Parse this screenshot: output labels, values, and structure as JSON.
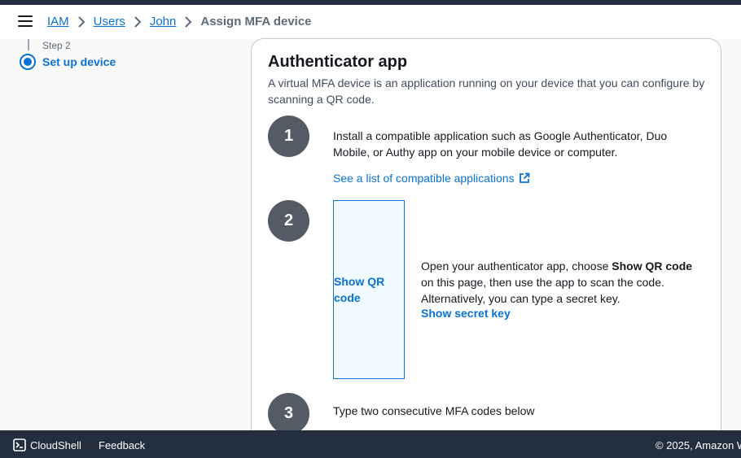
{
  "breadcrumb": {
    "items": [
      "IAM",
      "Users",
      "John"
    ],
    "current": "Assign MFA device"
  },
  "steps": {
    "caption": "Step 2",
    "title": "Set up device"
  },
  "card": {
    "title": "Authenticator app",
    "description": "A virtual MFA device is an application running on your device that you can configure by scanning a QR code.",
    "step1": {
      "number": "1",
      "text": "Install a compatible application such as Google Authenticator, Duo Mobile, or Authy app on your mobile device or computer.",
      "link": "See a list of compatible applications"
    },
    "step2": {
      "number": "2",
      "qr_button": "Show QR code",
      "text_pre": "Open your authenticator app, choose ",
      "text_bold": "Show QR code",
      "text_post": " on this page, then use the app to scan the code. Alternatively, you can type a secret key.",
      "link": "Show secret key"
    },
    "step3": {
      "number": "3",
      "text": "Type two consecutive MFA codes below"
    }
  },
  "footer": {
    "cloudshell": "CloudShell",
    "feedback": "Feedback",
    "copyright": "© 2025, Amazon W"
  },
  "colors": {
    "link": "#0972d3",
    "header_dark": "#232f3e",
    "step_circle": "#545b64"
  }
}
